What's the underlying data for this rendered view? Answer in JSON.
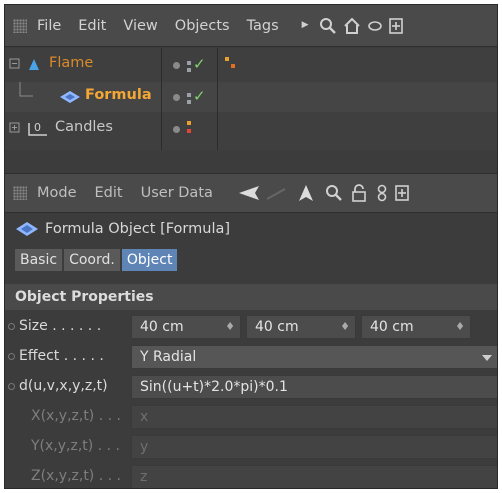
{
  "object_manager": {
    "menu": [
      "File",
      "Edit",
      "View",
      "Objects",
      "Tags"
    ],
    "objects": [
      {
        "name": "Flame",
        "color": "#d98a2a"
      },
      {
        "name": "Formula",
        "color": "#f3a734"
      },
      {
        "name": "Candles",
        "color": "#c8c8c8"
      }
    ]
  },
  "attribute_manager": {
    "menu": [
      "Mode",
      "Edit",
      "User Data"
    ],
    "title": "Formula Object [Formula]",
    "tabs": [
      "Basic",
      "Coord.",
      "Object"
    ],
    "active_tab": "Object",
    "section": "Object Properties",
    "size": {
      "label": "Size . . . . . .",
      "values": [
        "40 cm",
        "40 cm",
        "40 cm"
      ]
    },
    "effect": {
      "label": "Effect . . . . .",
      "value": "Y Radial"
    },
    "d": {
      "label": "d(u,v,x,y,z,t)",
      "value": "Sin((u+t)*2.0*pi)*0.1"
    },
    "x": {
      "label": "X(x,y,z,t) . . .",
      "value": "x"
    },
    "y": {
      "label": "Y(x,y,z,t) . . .",
      "value": "y"
    },
    "z": {
      "label": "Z(x,y,z,t) . . .",
      "value": "z"
    }
  },
  "colors": {
    "accent": "#5f84b6",
    "check": "#7ed46a",
    "dot_red": "#e0453a",
    "dot_orange": "#e8a030"
  }
}
